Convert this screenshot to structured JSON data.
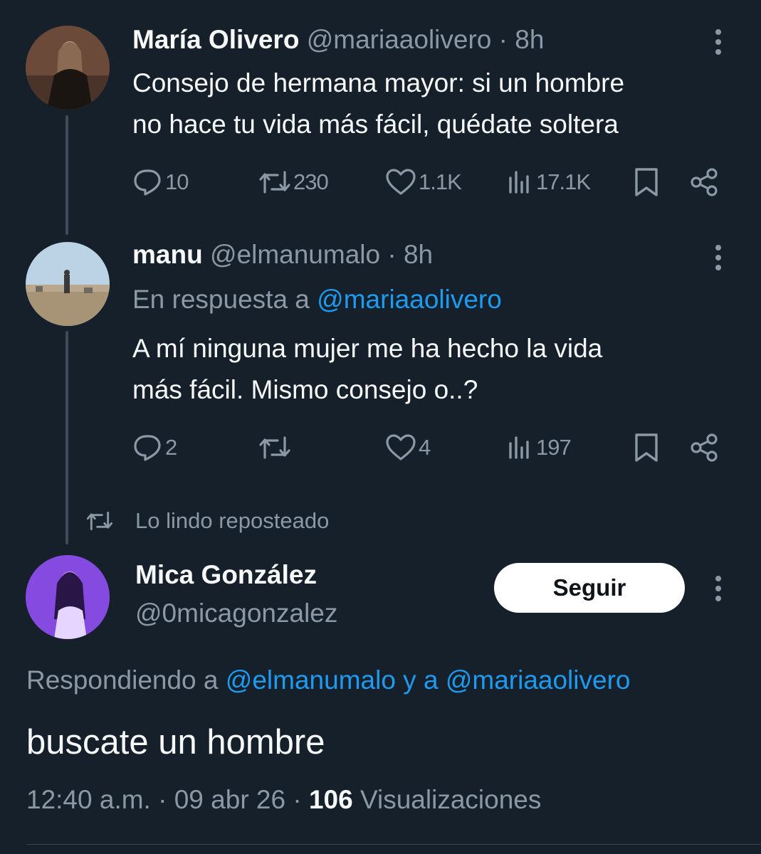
{
  "tweet1": {
    "name": "María Olivero",
    "handle": "@mariaaolivero",
    "sep": "·",
    "time": "8h",
    "text_line1": "Consejo de hermana mayor: si un hombre",
    "text_line2": "no hace tu vida más fácil, quédate soltera",
    "replies": "10",
    "reposts": "230",
    "likes": "1.1K",
    "views": "17.1K"
  },
  "tweet2": {
    "name": "manu",
    "handle": "@elmanumalo",
    "sep": "·",
    "time": "8h",
    "reply_prefix": "En respuesta a",
    "reply_to": "@mariaaolivero",
    "text_line1": "A mí ninguna mujer me ha hecho la vida",
    "text_line2": "más fácil. Mismo consejo o..?",
    "replies": "2",
    "likes": "4",
    "views": "197"
  },
  "repost_notice": "Lo lindo reposteado",
  "tweet3": {
    "name": "Mica González",
    "handle": "@0micagonzalez",
    "follow_label": "Seguir",
    "replying_prefix": "Respondiendo a",
    "replying_user1": "@elmanumalo",
    "replying_conj": "y a",
    "replying_user2": "@mariaaolivero",
    "text": "buscate un hombre",
    "time": "12:40 a.m.",
    "sep1": "·",
    "date": "09 abr 26",
    "sep2": "·",
    "views_count": "106",
    "views_label": "Visualizaciones"
  },
  "colors": {
    "background": "#15202b",
    "text": "#f7f9f9",
    "secondary": "#8b98a5",
    "accent": "#1d9bf0",
    "thread_line": "#3e4c59"
  }
}
